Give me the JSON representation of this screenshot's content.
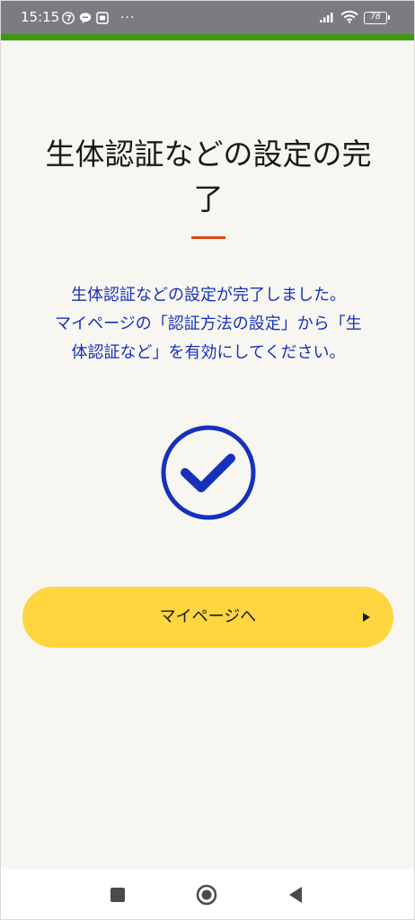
{
  "status_bar": {
    "time": "15:15",
    "battery_level": "78",
    "overflow_dots": "···",
    "icons_left": [
      "seven-eleven-icon",
      "chat-icon",
      "app-notification-icon"
    ],
    "icons_right": [
      "signal-icon",
      "wifi-icon",
      "battery-icon"
    ]
  },
  "colors": {
    "status_bar": "#7b7b80",
    "accent_bar": "#3d9a0f",
    "background": "#f8f6f0",
    "title_divider": "#e0451a",
    "message_text": "#1631bd",
    "check_icon": "#1631bd",
    "button_background": "#ffd540"
  },
  "main": {
    "title_line1": "生体認証などの設定の完",
    "title_line2": "了",
    "message_line1": "生体認証などの設定が完了しました。",
    "message_line2": "マイページの「認証方法の設定」から「生",
    "message_line3": "体認証など」を有効にしてください。",
    "status_icon": "check-circle-icon",
    "button_label": "マイページへ",
    "button_icon": "play-arrow-icon"
  },
  "nav_bar": {
    "icons": [
      "recents-square-icon",
      "home-circle-icon",
      "back-triangle-icon"
    ]
  }
}
